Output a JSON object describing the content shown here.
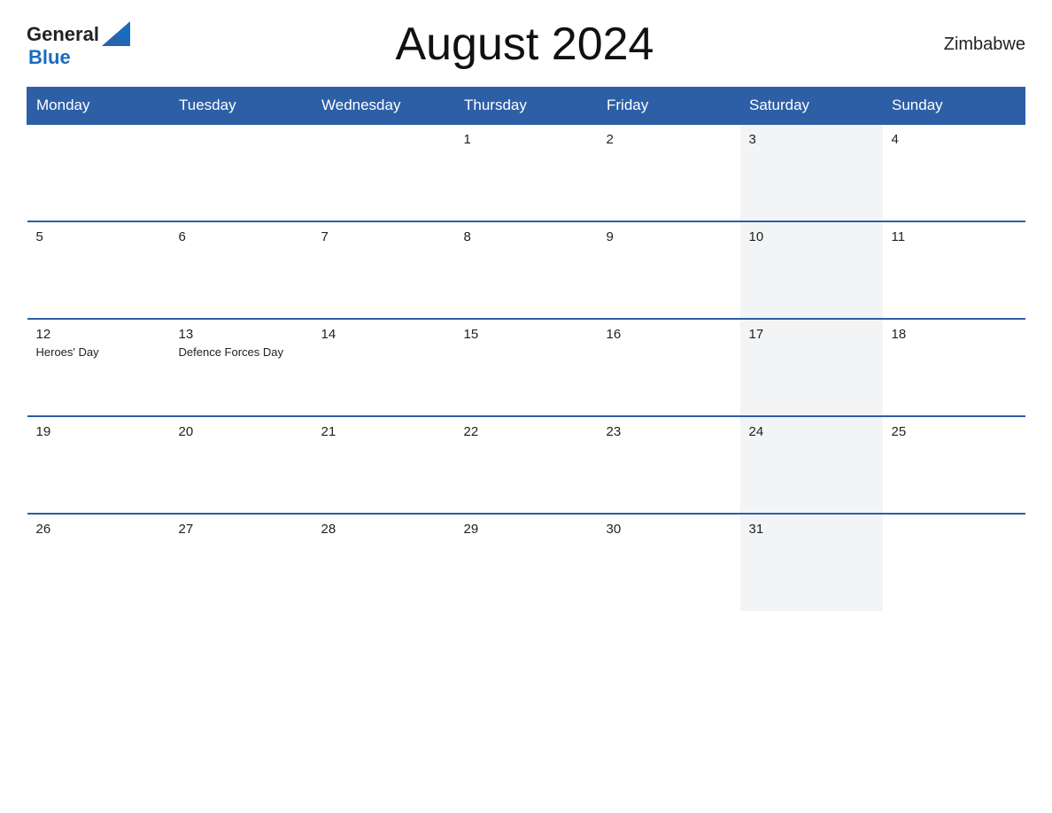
{
  "header": {
    "logo_general": "General",
    "logo_blue": "Blue",
    "month_title": "August 2024",
    "country": "Zimbabwe"
  },
  "weekdays": [
    "Monday",
    "Tuesday",
    "Wednesday",
    "Thursday",
    "Friday",
    "Saturday",
    "Sunday"
  ],
  "weeks": [
    [
      {
        "day": "",
        "holiday": "",
        "alt": false
      },
      {
        "day": "",
        "holiday": "",
        "alt": false
      },
      {
        "day": "",
        "holiday": "",
        "alt": false
      },
      {
        "day": "1",
        "holiday": "",
        "alt": false
      },
      {
        "day": "2",
        "holiday": "",
        "alt": false
      },
      {
        "day": "3",
        "holiday": "",
        "alt": true
      },
      {
        "day": "4",
        "holiday": "",
        "alt": false
      }
    ],
    [
      {
        "day": "5",
        "holiday": "",
        "alt": false
      },
      {
        "day": "6",
        "holiday": "",
        "alt": false
      },
      {
        "day": "7",
        "holiday": "",
        "alt": false
      },
      {
        "day": "8",
        "holiday": "",
        "alt": false
      },
      {
        "day": "9",
        "holiday": "",
        "alt": false
      },
      {
        "day": "10",
        "holiday": "",
        "alt": true
      },
      {
        "day": "11",
        "holiday": "",
        "alt": false
      }
    ],
    [
      {
        "day": "12",
        "holiday": "Heroes' Day",
        "alt": false
      },
      {
        "day": "13",
        "holiday": "Defence Forces Day",
        "alt": false
      },
      {
        "day": "14",
        "holiday": "",
        "alt": false
      },
      {
        "day": "15",
        "holiday": "",
        "alt": false
      },
      {
        "day": "16",
        "holiday": "",
        "alt": false
      },
      {
        "day": "17",
        "holiday": "",
        "alt": true
      },
      {
        "day": "18",
        "holiday": "",
        "alt": false
      }
    ],
    [
      {
        "day": "19",
        "holiday": "",
        "alt": false
      },
      {
        "day": "20",
        "holiday": "",
        "alt": false
      },
      {
        "day": "21",
        "holiday": "",
        "alt": false
      },
      {
        "day": "22",
        "holiday": "",
        "alt": false
      },
      {
        "day": "23",
        "holiday": "",
        "alt": false
      },
      {
        "day": "24",
        "holiday": "",
        "alt": true
      },
      {
        "day": "25",
        "holiday": "",
        "alt": false
      }
    ],
    [
      {
        "day": "26",
        "holiday": "",
        "alt": false
      },
      {
        "day": "27",
        "holiday": "",
        "alt": false
      },
      {
        "day": "28",
        "holiday": "",
        "alt": false
      },
      {
        "day": "29",
        "holiday": "",
        "alt": false
      },
      {
        "day": "30",
        "holiday": "",
        "alt": false
      },
      {
        "day": "31",
        "holiday": "",
        "alt": true
      },
      {
        "day": "",
        "holiday": "",
        "alt": false
      }
    ]
  ]
}
